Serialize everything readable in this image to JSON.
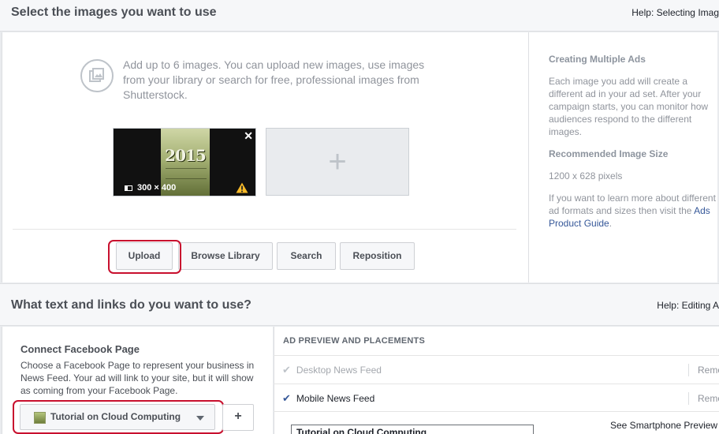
{
  "images_section": {
    "title": "Select the images you want to use",
    "help": "Help: Selecting Imag",
    "intro": "Add up to 6 images. You can upload new images, use images from your library or search for free, professional images from Shutterstock.",
    "thumbnail": {
      "year_text": "2015",
      "dimensions": "300 × 400",
      "close_glyph": "✕"
    },
    "add_slot_glyph": "+",
    "buttons": {
      "upload": "Upload",
      "browse": "Browse Library",
      "search": "Search",
      "reposition": "Reposition"
    },
    "sidebar": {
      "heading1": "Creating Multiple Ads",
      "para1": "Each image you add will create a different ad in your ad set. After your campaign starts, you can monitor how audiences respond to the different images.",
      "heading2": "Recommended Image Size",
      "size": "1200 x 628 pixels",
      "para3_prefix": "If you want to learn more about different ad formats and sizes then visit the ",
      "para3_link": "Ads Product Guide",
      "para3_suffix": "."
    }
  },
  "text_section": {
    "title": "What text and links do you want to use?",
    "help": "Help: Editing A",
    "connect_title": "Connect Facebook Page",
    "connect_desc": "Choose a Facebook Page to represent your business in News Feed. Your ad will link to your site, but it will show as coming from your Facebook Page.",
    "page_select": "Tutorial on Cloud Computing",
    "add_page": "+",
    "preview_title": "AD PREVIEW AND PLACEMENTS",
    "placements": [
      {
        "label": "Desktop News Feed",
        "checked": false,
        "remove": "Remo"
      },
      {
        "label": "Mobile News Feed",
        "checked": true,
        "remove": "Remo"
      }
    ],
    "smartphone_link": "See Smartphone Preview",
    "preview_text": "Tutorial on Cloud Computing"
  },
  "colors": {
    "highlight_ring": "#c8102e",
    "link": "#365899",
    "warning": "#f7b928"
  },
  "icons": [
    "image-library-icon",
    "close-icon",
    "image-size-icon",
    "warning-icon",
    "plus-icon",
    "checkmark-icon",
    "chevron-down-icon"
  ]
}
